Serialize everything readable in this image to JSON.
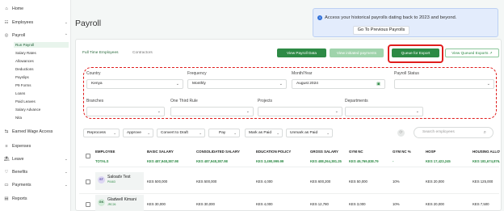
{
  "sidebar": {
    "items": [
      {
        "icon": "home-icon",
        "glyph": "⌂",
        "label": "Home"
      },
      {
        "icon": "employees-icon",
        "glyph": "☷",
        "label": "Employees",
        "caret": "⌄"
      },
      {
        "icon": "payroll-icon",
        "glyph": "◎",
        "label": "Payroll",
        "caret": "⌃"
      },
      {
        "icon": "earned-wage-icon",
        "glyph": "⇆",
        "label": "Earned Wage Access"
      },
      {
        "icon": "expenses-icon",
        "glyph": "≡",
        "label": "Expenses"
      },
      {
        "icon": "leave-icon",
        "glyph": "⛱",
        "label": "Leave",
        "caret": "⌄"
      },
      {
        "icon": "benefits-icon",
        "glyph": "♡",
        "label": "Benefits",
        "caret": "⌄"
      },
      {
        "icon": "payments-icon",
        "glyph": "▭",
        "label": "Payments",
        "caret": "⌄"
      },
      {
        "icon": "reports-icon",
        "glyph": "▤",
        "label": "Reports"
      }
    ],
    "payroll_sub": [
      "Run Payroll",
      "Salary Rates",
      "Allowances",
      "Deductions",
      "Payslips",
      "P9 Forms",
      "Loans",
      "Paid Leaves",
      "Salary Advance",
      "Nita"
    ]
  },
  "header": {
    "title": "Payroll"
  },
  "notice": {
    "text": "Access your historical payrolls dating back to 2023 and beyond.",
    "button": "Go To Previous Payrolls"
  },
  "tabs": [
    "Full Time Employees",
    "Contractors"
  ],
  "actions": {
    "view_payroll_data": "View Payroll Data",
    "view_initiated_payments": "View initiated payments",
    "queue_for_export": "Queue for Export",
    "view_queued_exports": "View Queued Exports"
  },
  "filters": {
    "country": {
      "label": "Country",
      "value": "Kenya"
    },
    "frequency": {
      "label": "Frequency",
      "value": "Monthly"
    },
    "month_year": {
      "label": "Month/Year",
      "value": "August 2024"
    },
    "payroll_status": {
      "label": "Payroll Status",
      "value": ""
    },
    "branches": {
      "label": "Branches",
      "value": ""
    },
    "one_third_rule": {
      "label": "One Third Rule",
      "value": ""
    },
    "projects": {
      "label": "Projects",
      "value": ""
    },
    "departments": {
      "label": "Departments",
      "value": ""
    }
  },
  "bulk_actions": [
    "Reprocess",
    "Approve",
    "Convert to Draft",
    "Pay",
    "Mark as Paid",
    "Unmark as Paid"
  ],
  "search": {
    "placeholder": "Search employees"
  },
  "table": {
    "headers": [
      "EMPLOYEE",
      "BASIC SALARY",
      "CONSOLIDATED SALARY",
      "EDUCATION POLICY",
      "GROSS SALARY",
      "GYM NC",
      "GYM NC %",
      "HOSP",
      "HOUSING ALLOW"
    ],
    "totals": [
      "TOTALS",
      "KES 487,948,387.98",
      "KES 487,948,387.98",
      "KES 3,490,999.99",
      "KES 488,264,381.25",
      "KES 49,769,838.79",
      "-",
      "KES 17,423,245",
      "KES 181,674,876."
    ],
    "rows": [
      {
        "initials": "ST",
        "name": "Saloadv Test",
        "id": "P0463",
        "avatar_bg": "#ddd7f3",
        "avatar_fg": "#5b4fa8",
        "cells": [
          "KES 500,000",
          "KES 500,000",
          "KES 4,000",
          "KES 600,200",
          "KES 50,000",
          "10%",
          "KES 20,000",
          "KES 125,000"
        ]
      },
      {
        "initials": "GK",
        "name": "Gladwell Kimani",
        "id": "JRC26",
        "avatar_bg": "#d3ecd9",
        "avatar_fg": "#2d6b3f",
        "cells": [
          "KES 30,000",
          "KES 30,000",
          "KES 4,000",
          "KES 12,780",
          "KES 3,000",
          "10%",
          "KES 20,000",
          "KES 7,500"
        ]
      }
    ]
  },
  "colors": {
    "brand": "#2d8a45",
    "highlight": "#e01d1d",
    "notice_bg": "#e3ecfc"
  }
}
